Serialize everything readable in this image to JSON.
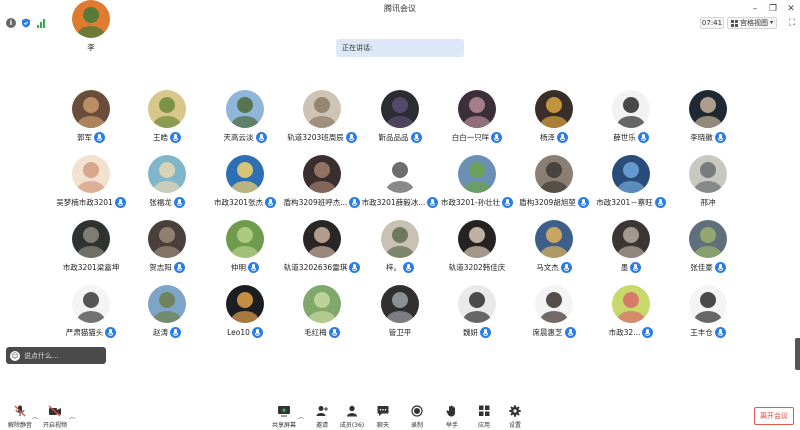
{
  "window": {
    "title": "腾讯会议",
    "controls": [
      "minimize-icon",
      "restore-icon",
      "close-icon"
    ]
  },
  "info": {
    "timer": "07:41",
    "view_label": "宫格视图",
    "icons": [
      "info-icon",
      "shield-icon",
      "signal-icon",
      "fullscreen-icon"
    ]
  },
  "speaking": {
    "label": "正在讲话:"
  },
  "participants": [
    {
      "name": "郭军",
      "mic": true,
      "bg": "#6a4d3a",
      "fg": "#c99a6b"
    },
    {
      "name": "王皓",
      "mic": true,
      "bg": "#d9c68a",
      "fg": "#6a8a3a"
    },
    {
      "name": "天高云淡",
      "mic": true,
      "bg": "#8db6d9",
      "fg": "#4f6a3a"
    },
    {
      "name": "轨道3203班周辰",
      "mic": true,
      "bg": "#cfc3b3",
      "fg": "#8b7b66"
    },
    {
      "name": "靳品品品",
      "mic": true,
      "bg": "#2c2c33",
      "fg": "#5c4f73"
    },
    {
      "name": "白白一只咩",
      "mic": true,
      "bg": "#3a2f3a",
      "fg": "#b88a99"
    },
    {
      "name": "杨泽",
      "mic": true,
      "bg": "#3a2e28",
      "fg": "#d9a441"
    },
    {
      "name": "薛世乐",
      "mic": true,
      "bg": "#f2f2f2",
      "fg": "#2b2b2b"
    },
    {
      "name": "李晓徽",
      "mic": true,
      "bg": "#1f2933",
      "fg": "#c6b39a"
    },
    {
      "name": "吴梦楠市政3201",
      "mic": true,
      "bg": "#f3e1d0",
      "fg": "#d49a80"
    },
    {
      "name": "张福龙",
      "mic": true,
      "bg": "#7fb6c9",
      "fg": "#e8d7b4"
    },
    {
      "name": "市政3201张杰",
      "mic": true,
      "bg": "#2d6fb5",
      "fg": "#f4d36a"
    },
    {
      "name": "盾构3209班呼杰...",
      "mic": true,
      "bg": "#3b2e2e",
      "fg": "#a07f6c"
    },
    {
      "name": "市政3201薛毅冰...",
      "mic": true,
      "bg": "#ffffff",
      "fg": "#555555"
    },
    {
      "name": "市政3201-孙壮壮",
      "mic": true,
      "bg": "#6b8fb3",
      "fg": "#6aa34a"
    },
    {
      "name": "盾构3209胡旭堃",
      "mic": true,
      "bg": "#8a7f72",
      "fg": "#3d3a35"
    },
    {
      "name": "市政3201－蔡旺",
      "mic": true,
      "bg": "#2a4c7a",
      "fg": "#6fa8dc"
    },
    {
      "name": "邢冲",
      "mic": false,
      "bg": "#c8c8c0",
      "fg": "#6b6f73"
    },
    {
      "name": "市政3201梁嘉坤",
      "mic": false,
      "bg": "#2f3330",
      "fg": "#8c8a7f"
    },
    {
      "name": "贺志阳",
      "mic": true,
      "bg": "#4a3f3a",
      "fg": "#9c8a7a"
    },
    {
      "name": "仲明",
      "mic": true,
      "bg": "#6f9b4f",
      "fg": "#b8d18a"
    },
    {
      "name": "轨道3202636雷琪",
      "mic": true,
      "bg": "#2a2626",
      "fg": "#c9b2a0"
    },
    {
      "name": "梓。",
      "mic": true,
      "bg": "#c9c2b4",
      "fg": "#5e6b4f"
    },
    {
      "name": "轨道3202韩佳庆",
      "mic": false,
      "bg": "#26221f",
      "fg": "#d8cbb8"
    },
    {
      "name": "马文杰",
      "mic": true,
      "bg": "#3e5f8a",
      "fg": "#e0b25a"
    },
    {
      "name": "墨",
      "mic": true,
      "bg": "#3b3534",
      "fg": "#b7a89f"
    },
    {
      "name": "张佳豪",
      "mic": true,
      "bg": "#5f6f7c",
      "fg": "#9cb36b"
    },
    {
      "name": "严肃猫猫头",
      "mic": true,
      "bg": "#f4f4f4",
      "fg": "#3a3a3a"
    },
    {
      "name": "赵涛",
      "mic": true,
      "bg": "#7ea4c8",
      "fg": "#6c7f4a"
    },
    {
      "name": "Leo10",
      "mic": true,
      "bg": "#1c1f22",
      "fg": "#e3a04a"
    },
    {
      "name": "毛红梅",
      "mic": true,
      "bg": "#7fa86a",
      "fg": "#c7d9a0"
    },
    {
      "name": "管卫平",
      "mic": false,
      "bg": "#2f2f2f",
      "fg": "#9aa0a6"
    },
    {
      "name": "魏妍",
      "mic": true,
      "bg": "#e9e9e9",
      "fg": "#2e2e2e"
    },
    {
      "name": "席晨惠芝",
      "mic": true,
      "bg": "#f4f4f4",
      "fg": "#3a2f2a"
    },
    {
      "name": "市政32...",
      "mic": true,
      "bg": "#c8d96b",
      "fg": "#d86a6a"
    },
    {
      "name": "王丰仓",
      "mic": true,
      "bg": "#f4f4f4",
      "fg": "#2b2b2b"
    },
    {
      "name": "李",
      "mic": false,
      "bg": "#e07a2e",
      "fg": "#3f7a3a"
    }
  ],
  "chat": {
    "placeholder": "说点什么..."
  },
  "toolbar": {
    "unmute": "解除静音",
    "start_video": "开启视频",
    "share_screen": "共享屏幕",
    "invite": "邀请",
    "members": "成员(36)",
    "chat": "聊天",
    "record": "录制",
    "raise_hand": "举手",
    "apps": "应用",
    "settings": "设置",
    "leave": "离开会议"
  }
}
